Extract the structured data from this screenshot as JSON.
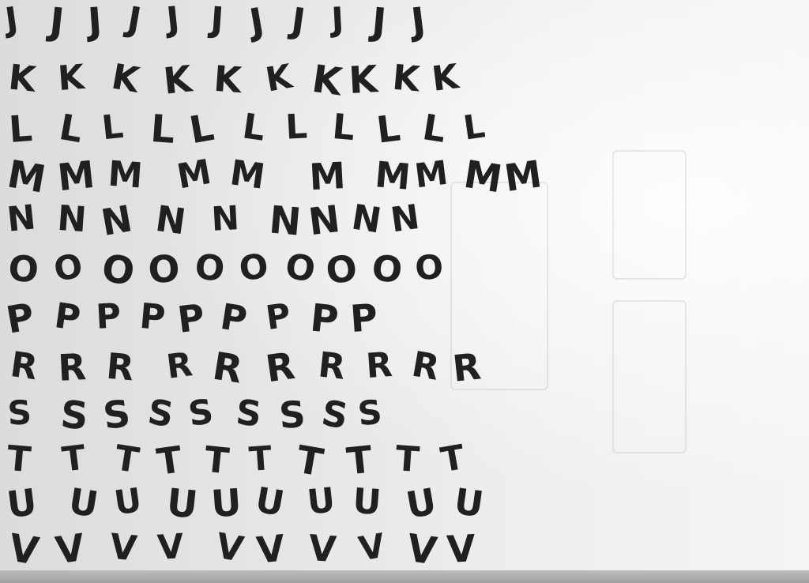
{
  "sheet": {
    "rows": [
      {
        "letter": "J",
        "glyphs": [
          "J",
          "J",
          "J",
          "J",
          "J",
          "J",
          "J",
          "J",
          "J",
          "J",
          "J"
        ]
      },
      {
        "letter": "K",
        "glyphs": [
          "K",
          "K",
          "K",
          "K",
          "K",
          "K",
          "K",
          "K",
          "K",
          "K"
        ]
      },
      {
        "letter": "L",
        "glyphs": [
          "L",
          "L",
          "L",
          "L",
          "L",
          "L",
          "L",
          "L",
          "L",
          "L",
          "L"
        ]
      },
      {
        "letter": "M",
        "glyphs": [
          "M",
          "M",
          "M",
          "M",
          "M",
          "M",
          "M",
          "M",
          "M",
          "M"
        ]
      },
      {
        "letter": "N",
        "glyphs": [
          "N",
          "N",
          "N",
          "N",
          "N",
          "N",
          "N",
          "N",
          "N"
        ]
      },
      {
        "letter": "O",
        "glyphs": [
          "O",
          "O",
          "O",
          "O",
          "O",
          "O",
          "O",
          "O",
          "O",
          "O"
        ]
      },
      {
        "letter": "P",
        "glyphs": [
          "P",
          "P",
          "P",
          "P",
          "P",
          "P",
          "P",
          "P",
          "P"
        ]
      },
      {
        "letter": "R",
        "glyphs": [
          "R",
          "R",
          "R",
          "R",
          "R",
          "R",
          "R",
          "R",
          "R",
          "R"
        ]
      },
      {
        "letter": "S",
        "glyphs": [
          "S",
          "S",
          "S",
          "S",
          "S",
          "S",
          "S",
          "S",
          "S"
        ]
      },
      {
        "letter": "T",
        "glyphs": [
          "T",
          "T",
          "T",
          "T",
          "T",
          "T",
          "T",
          "T",
          "T",
          "T"
        ]
      },
      {
        "letter": "U",
        "glyphs": [
          "U",
          "U",
          "U",
          "U",
          "U",
          "U",
          "U",
          "U",
          "U",
          "U"
        ]
      },
      {
        "letter": "V",
        "glyphs": [
          "V",
          "V",
          "V",
          "V",
          "V",
          "V",
          "V",
          "V",
          "V",
          "V"
        ]
      }
    ]
  },
  "colors": {
    "ink": "#202020",
    "paper": "#e9e9e9"
  }
}
